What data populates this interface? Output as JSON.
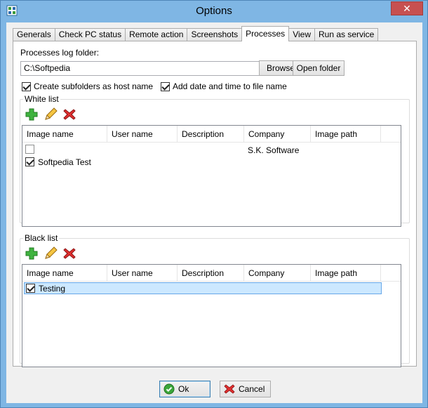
{
  "window": {
    "title": "Options",
    "close_glyph": "✕"
  },
  "tabs": [
    {
      "label": "Generals"
    },
    {
      "label": "Check PC status"
    },
    {
      "label": "Remote action"
    },
    {
      "label": "Screenshots"
    },
    {
      "label": "Processes",
      "active": true
    },
    {
      "label": "View"
    },
    {
      "label": "Run as service"
    }
  ],
  "processes": {
    "log_folder_label": "Processes log folder:",
    "log_folder_value": "C:\\Softpedia",
    "browse_label": "Browse",
    "open_folder_label": "Open folder",
    "create_subfolders_label": "Create subfolders as host name",
    "create_subfolders_checked": true,
    "add_date_label": "Add date and time to file name",
    "add_date_checked": true
  },
  "white_list": {
    "title": "White list",
    "toolbar": [
      "add-icon",
      "edit-icon",
      "delete-icon"
    ],
    "columns": [
      "Image name",
      "User name",
      "Description",
      "Company",
      "Image path"
    ],
    "rows": [
      {
        "checked": false,
        "image_name": "",
        "user_name": "",
        "description": "",
        "company": "S.K. Software",
        "image_path": ""
      },
      {
        "checked": true,
        "image_name": "Softpedia Test",
        "user_name": "",
        "description": "",
        "company": "",
        "image_path": ""
      }
    ]
  },
  "black_list": {
    "title": "Black list",
    "toolbar": [
      "add-icon",
      "edit-icon",
      "delete-icon"
    ],
    "columns": [
      "Image name",
      "User name",
      "Description",
      "Company",
      "Image path"
    ],
    "rows": [
      {
        "checked": true,
        "image_name": "Testing",
        "selected": true
      }
    ]
  },
  "footer": {
    "ok_label": "Ok",
    "cancel_label": "Cancel"
  },
  "colors": {
    "accent": "#7fb6e4",
    "selection": "#cce8ff",
    "close": "#c75050"
  }
}
